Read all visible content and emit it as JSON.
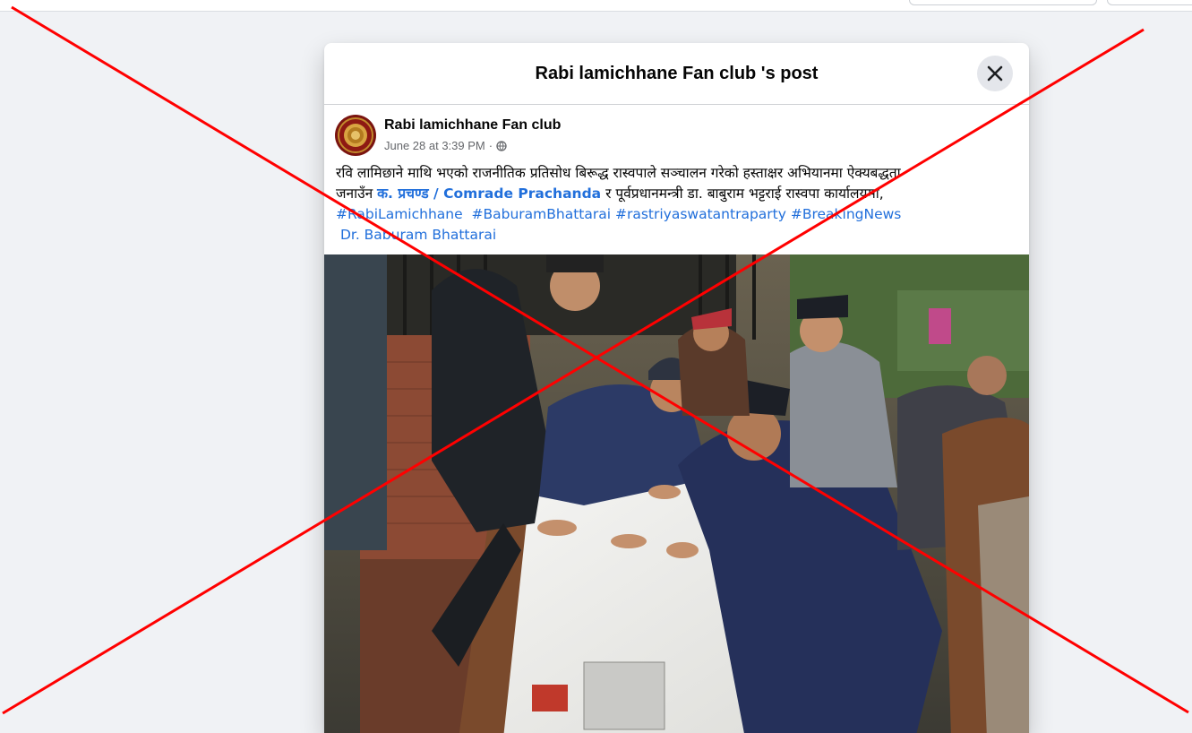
{
  "modal": {
    "title": "Rabi lamichhane Fan club 's post",
    "close_icon": "close-icon"
  },
  "post": {
    "author": "Rabi lamichhane Fan club",
    "timestamp": "June 28 at 3:39 PM",
    "separator": "·",
    "audience_icon": "globe-icon",
    "text": {
      "line1": "रवि लामिछाने माथि भएको राजनीतिक प्रतिसोध बिरूद्ध रास्वपाले सञ्चालन गरेको हस्ताक्षर अभियानमा ऐक्यबद्धता",
      "line2_prefix": "जनाउँन ",
      "mention1": "क. प्रचण्ड / Comrade Prachanda",
      "line2_suffix": " र  पूर्वप्रधानमन्त्री डा. बाबुराम भट्टराई रास्वपा कार्यालयमा,",
      "hashtags": [
        "#RabiLamichhane",
        "#BaburamBhattarai",
        "#rastriyaswatantraparty",
        "#BreakingNews"
      ],
      "mention2": "Dr. Baburam Bhattarai"
    }
  },
  "overlay": {
    "cross_color": "#ff0000"
  },
  "colors": {
    "link": "#216fdb",
    "background": "#f0f2f5"
  }
}
